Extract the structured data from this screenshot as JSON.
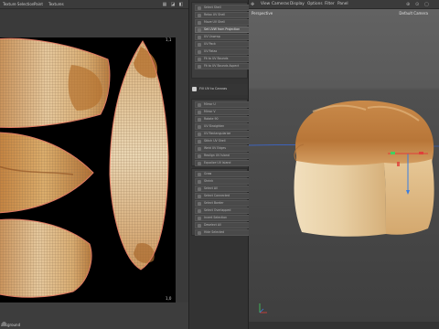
{
  "uv_editor": {
    "menu": [
      "Texture Selection",
      "Paint",
      "Textures"
    ],
    "corner_top_right": "1,1",
    "corner_bottom_right": "1,0",
    "status_text": "ackground"
  },
  "tool_panel": {
    "group_a": [
      {
        "label": "Select Shell"
      },
      {
        "label": "Relax UV Shell"
      },
      {
        "label": "Move UV Shell"
      },
      {
        "label": "Set UVW from Projection",
        "active": true
      },
      {
        "label": "UV Unwrap"
      },
      {
        "label": "UV Pack"
      },
      {
        "label": "UV Relax"
      },
      {
        "label": "Fit to UV Bounds"
      },
      {
        "label": "Fit to UV Bounds Aspect"
      }
    ],
    "group_b_title": "Fill UV to Canvas",
    "group_b": [
      {
        "label": "Mirror U"
      },
      {
        "label": "Mirror V"
      },
      {
        "label": "Rotate 90"
      },
      {
        "label": "UV Straighten"
      },
      {
        "label": "UV Rectangularize"
      },
      {
        "label": "Stitch UV Shell"
      },
      {
        "label": "Weld UV Edges"
      },
      {
        "label": "Realign UV Island"
      },
      {
        "label": "Equalize UV Island"
      }
    ],
    "group_c": [
      {
        "label": "Grow"
      },
      {
        "label": "Shrink"
      },
      {
        "label": "Select All"
      },
      {
        "label": "Select Connected"
      },
      {
        "label": "Select Border"
      },
      {
        "label": "Select Overlapped"
      },
      {
        "label": "Invert Selection"
      },
      {
        "label": "Deselect All"
      },
      {
        "label": "Hide Selected"
      }
    ]
  },
  "viewport": {
    "menu": [
      "View",
      "Cameras",
      "Display",
      "Options",
      "Filter",
      "Panel"
    ],
    "label": "Perspective",
    "camera": "Default Camera"
  },
  "colors": {
    "accent": "#c98a63",
    "x_axis": "#e0403a",
    "y_axis": "#40d060",
    "z_axis": "#3a7de0"
  },
  "icons": {
    "uv_menu_icons": [
      "grid-icon",
      "lock-icon",
      "settings-icon"
    ],
    "vp_menu_icons": [
      "move-icon",
      "camera-icon",
      "zoom-icon",
      "maximize-icon"
    ]
  }
}
